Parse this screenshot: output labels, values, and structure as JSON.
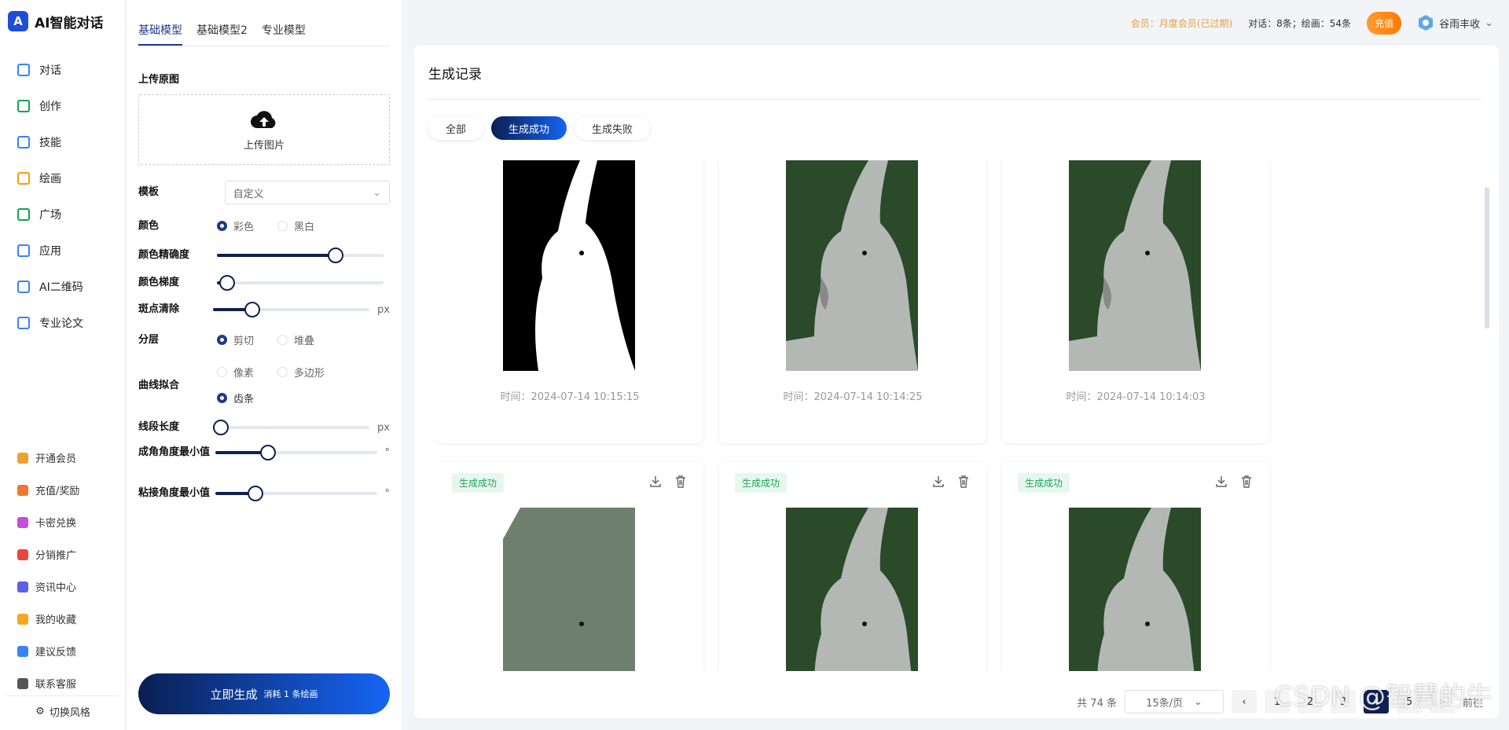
{
  "app": {
    "title": "AI智能对话"
  },
  "sidebar": {
    "items": [
      {
        "label": "对话",
        "icon": "chat-icon"
      },
      {
        "label": "创作",
        "icon": "pen-icon"
      },
      {
        "label": "技能",
        "icon": "skill-icon"
      },
      {
        "label": "绘画",
        "icon": "palette-icon"
      },
      {
        "label": "广场",
        "icon": "plaza-icon"
      },
      {
        "label": "应用",
        "icon": "apps-icon"
      },
      {
        "label": "AI二维码",
        "icon": "qrcode-icon"
      },
      {
        "label": "专业论文",
        "icon": "paper-icon"
      }
    ],
    "bottom_items": [
      {
        "label": "开通会员",
        "icon": "crown-icon",
        "color": "#f0a030"
      },
      {
        "label": "充值/奖励",
        "icon": "coin-icon",
        "color": "#f0772f"
      },
      {
        "label": "卡密兑换",
        "icon": "card-icon",
        "color": "#c54ed8"
      },
      {
        "label": "分销推广",
        "icon": "share-icon",
        "color": "#e8463f"
      },
      {
        "label": "资讯中心",
        "icon": "news-icon",
        "color": "#5b62e8"
      },
      {
        "label": "我的收藏",
        "icon": "star-icon",
        "color": "#f5a623"
      },
      {
        "label": "建议反馈",
        "icon": "feedback-icon",
        "color": "#3b82f6"
      },
      {
        "label": "联系客服",
        "icon": "headset-icon",
        "color": "#555555"
      }
    ],
    "switch_style": "切换风格"
  },
  "panel": {
    "tabs": [
      "基础模型",
      "基础模型2",
      "专业模型"
    ],
    "upload_title": "上传原图",
    "upload_button": "上传图片",
    "template": {
      "label": "模板",
      "value": "自定义"
    },
    "color": {
      "label": "颜色",
      "options": [
        "彩色",
        "黑白"
      ],
      "selected": 0
    },
    "color_precision": {
      "label": "颜色精确度",
      "value": 0.71
    },
    "color_gradient": {
      "label": "颜色梯度",
      "value": 0.06
    },
    "speckle": {
      "label": "斑点清除",
      "value": 0.25,
      "unit": "px"
    },
    "layering": {
      "label": "分层",
      "options": [
        "剪切",
        "堆叠"
      ],
      "selected": 0
    },
    "curve_fit": {
      "label": "曲线拟合",
      "options": [
        "像素",
        "多边形",
        "齿条"
      ],
      "selected": 2
    },
    "segment_length": {
      "label": "线段长度",
      "value": 0.05,
      "unit": "px"
    },
    "corner_min": {
      "label": "成角角度最小值",
      "value": 0.33,
      "unit": "°"
    },
    "splice_min": {
      "label": "粘接角度最小值",
      "value": 0.25,
      "unit": "°"
    },
    "generate": {
      "label": "立即生成",
      "cost": "消耗 1 条绘画"
    }
  },
  "topbar": {
    "member": "会员：月度会员(已过期)",
    "quota": "对话：8条；绘画：54条",
    "recharge": "充值",
    "username": "谷雨丰收"
  },
  "main": {
    "title": "生成记录",
    "filters": [
      "全部",
      "生成成功",
      "生成失败"
    ],
    "active_filter": 1,
    "cards_row1": [
      {
        "time": "时间：2024-07-14 10:15:15"
      },
      {
        "time": "时间：2024-07-14 10:14:25"
      },
      {
        "time": "时间：2024-07-14 10:14:03"
      }
    ],
    "cards_row2": [
      {
        "badge": "生成成功"
      },
      {
        "badge": "生成成功"
      },
      {
        "badge": "生成成功"
      }
    ],
    "pagination": {
      "total": "共 74 条",
      "page_size": "15条/页",
      "pages": [
        "1",
        "2",
        "3",
        "4",
        "5"
      ],
      "current": 4,
      "goto": "前往"
    },
    "watermark": "CSDN @智慧的牛"
  }
}
